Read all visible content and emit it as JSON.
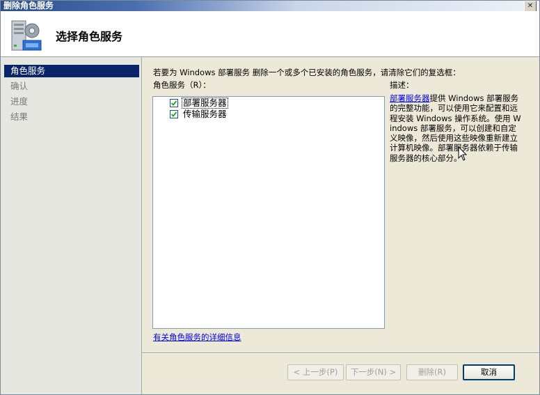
{
  "window": {
    "title": "删除角色服务",
    "close_symbol": "✕"
  },
  "header": {
    "title": "选择角色服务",
    "icon": "server-roles-icon"
  },
  "sidebar": {
    "items": [
      {
        "label": "角色服务",
        "active": true
      },
      {
        "label": "确认",
        "active": false
      },
      {
        "label": "进度",
        "active": false
      },
      {
        "label": "结果",
        "active": false
      }
    ]
  },
  "main": {
    "instruction": "若要为 Windows 部署服务 删除一个或多个已安装的角色服务，请清除它们的复选框：",
    "roles_label": "角色服务（R）：",
    "roles": [
      {
        "label": "部署服务器",
        "checked": true,
        "focused": true
      },
      {
        "label": "传输服务器",
        "checked": true,
        "focused": false
      }
    ],
    "description_label": "描述：",
    "description_link": "部署服务器",
    "description_text": "提供 Windows 部署服务的完整功能，可以使用它来配置和远程安装 Windows 操作系统。使用 Windows 部署服务，可以创建和自定义映像，然后使用这些映像重新建立计算机映像。部署服务器依赖于传输服务器的核心部分。",
    "more_info_link": "有关角色服务的详细信息"
  },
  "buttons": {
    "prev": "< 上一步(P)",
    "next": "下一步(N) >",
    "remove": "删除(R)",
    "cancel": "取消"
  },
  "colors": {
    "selection": "#0a246a",
    "link": "#0000ee",
    "dialog_bg": "#ece9d8"
  }
}
